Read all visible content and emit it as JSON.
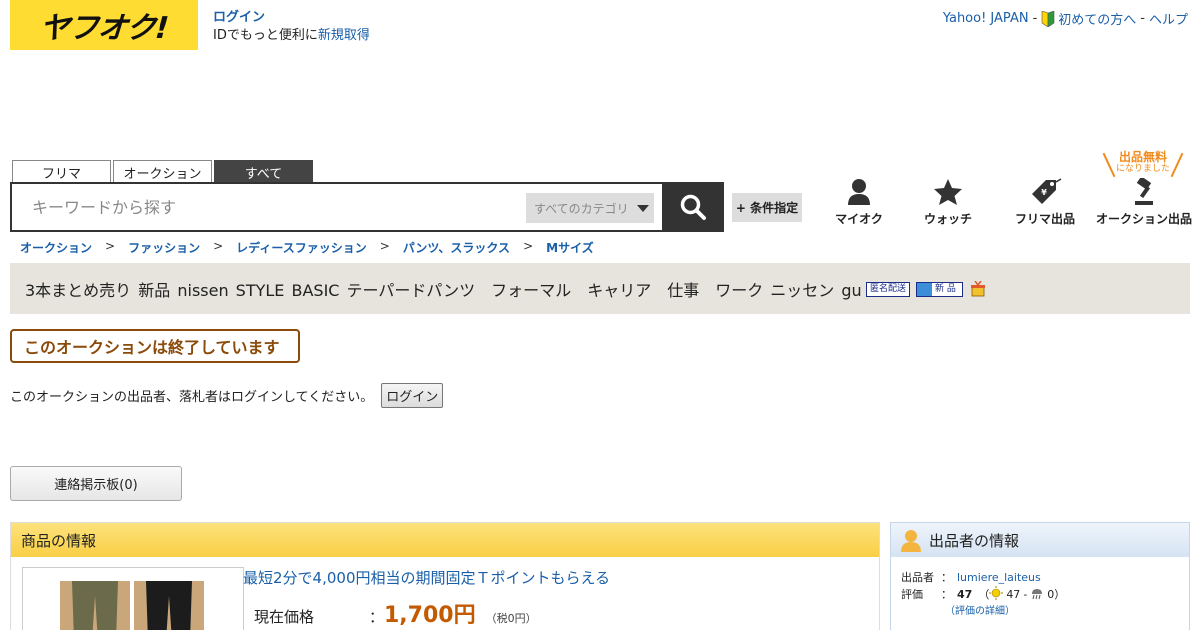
{
  "header": {
    "logo_text": "ヤフオク!",
    "login_label": "ログイン",
    "login_sub": "IDでもっと便利に",
    "register_label": "新規取得",
    "links": [
      "Yahoo! JAPAN",
      "初めての方へ",
      "ヘルプ"
    ],
    "link_sep": "-"
  },
  "search": {
    "tabs": [
      "フリマ",
      "オークション",
      "すべて"
    ],
    "active_tab": "すべて",
    "placeholder": "キーワードから探す",
    "category": "すべてのカテゴリ",
    "condition_label": "+ 条件指定"
  },
  "nav": {
    "items": [
      "マイオク",
      "ウォッチ",
      "フリマ出品",
      "オークション出品"
    ],
    "free_badge_line1": "出品無料",
    "free_badge_line2": "になりました"
  },
  "breadcrumb": [
    "オークション",
    "ファッション",
    "レディースファッション",
    "パンツ、スラックス",
    "Mサイズ"
  ],
  "breadcrumb_sep": ">",
  "item": {
    "title": "3本まとめ売り 新品 nissen STYLE BASIC テーパードパンツ　フォーマル　キャリア　仕事　ワーク ニッセン gu",
    "tag_anonymous": "匿名配送",
    "tag_new": "新 品"
  },
  "status": {
    "ended_text": "このオークションは終了しています",
    "login_note": "このオークションの出品者、落札者はログインしてください。",
    "login_button": "ログイン",
    "board_button": "連絡掲示板(0)"
  },
  "item_info": {
    "heading": "商品の情報",
    "promo": "最短2分で4,000円相当の期間固定Ｔポイントもらえる",
    "price_label": "現在価格",
    "colon": "：",
    "price_value": "1,700円",
    "price_tax": "（税0円）"
  },
  "seller": {
    "heading": "出品者の情報",
    "name_label": "出品者",
    "name": "lumiere_laiteus",
    "rating_label": "評価",
    "colon": "：",
    "rating_total": "47",
    "rating_good": "47",
    "rating_bad": "0",
    "rating_detail": "（評価の詳細）",
    "open_paren": "（",
    "dash": "-",
    "close_paren": "）"
  },
  "colors": {
    "logo_yellow": "#ffdc32",
    "link_blue": "#1a5fa8",
    "ended_brown": "#8a4a0a",
    "price_orange": "#c45a00",
    "badge_orange": "#f08c1e"
  }
}
